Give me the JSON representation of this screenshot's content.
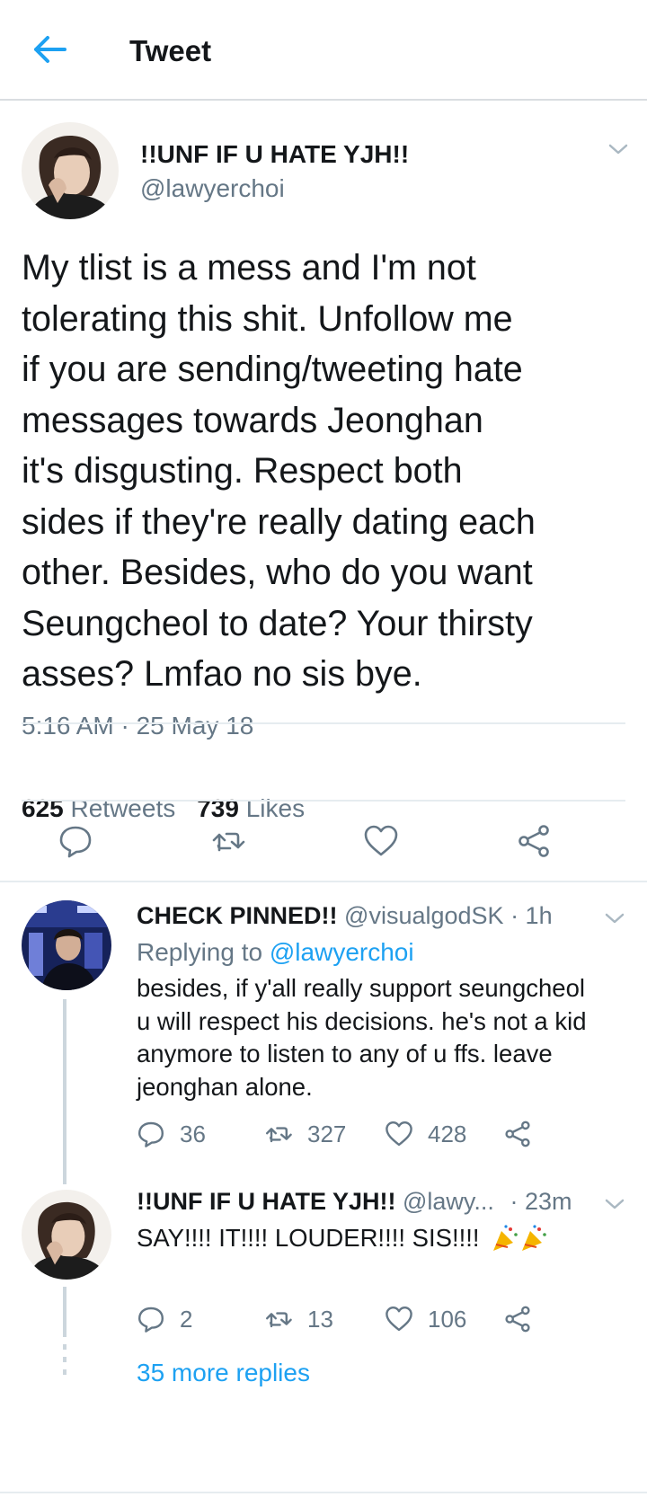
{
  "topbar": {
    "title": "Tweet"
  },
  "main_tweet": {
    "display_name": "!!UNF IF U HATE YJH!!",
    "handle": "@lawyerchoi",
    "text_lines": [
      "My tlist is a mess and I'm not",
      "tolerating this shit. Unfollow me",
      "if you are sending/tweeting hate",
      "messages towards Jeonghan",
      "it's disgusting. Respect both",
      "sides if they're really dating each",
      "other. Besides, who do you want",
      "Seungcheol to date? Your thirsty",
      "asses? Lmfao no sis bye."
    ],
    "timestamp": "5:16 AM · 25 May 18",
    "retweets_count": "625",
    "retweets_label": "Retweets",
    "likes_count": "739",
    "likes_label": "Likes"
  },
  "replies": [
    {
      "display_name": "CHECK PINNED!!",
      "handle": "@visualgodSK",
      "time": "· 1h",
      "replying_label": "Replying to",
      "replying_to": "@lawyerchoi",
      "text_lines": [
        "besides, if y'all really support seungcheol",
        "u will respect his decisions. he's not a kid",
        "anymore to listen to any of u ffs. leave",
        "jeonghan alone."
      ],
      "reply_count": "36",
      "retweet_count": "327",
      "like_count": "428"
    },
    {
      "display_name": "!!UNF IF U HATE YJH!!",
      "handle": "@lawy...",
      "time": "· 23m",
      "text": "SAY!!!! IT!!!! LOUDER!!!! SIS!!!!",
      "reply_count": "2",
      "retweet_count": "13",
      "like_count": "106"
    }
  ],
  "more_replies": "35 more replies",
  "colors": {
    "accent": "#1da1f2",
    "text": "#14171a",
    "muted": "#657786",
    "divider": "#e6ecf0"
  },
  "icons": {
    "back": "back-arrow-icon",
    "reply": "reply-bubble-icon",
    "retweet": "retweet-icon",
    "like": "heart-icon",
    "share": "share-icon",
    "menu": "chevron-down-icon",
    "emoji": "party-popper-icon"
  }
}
